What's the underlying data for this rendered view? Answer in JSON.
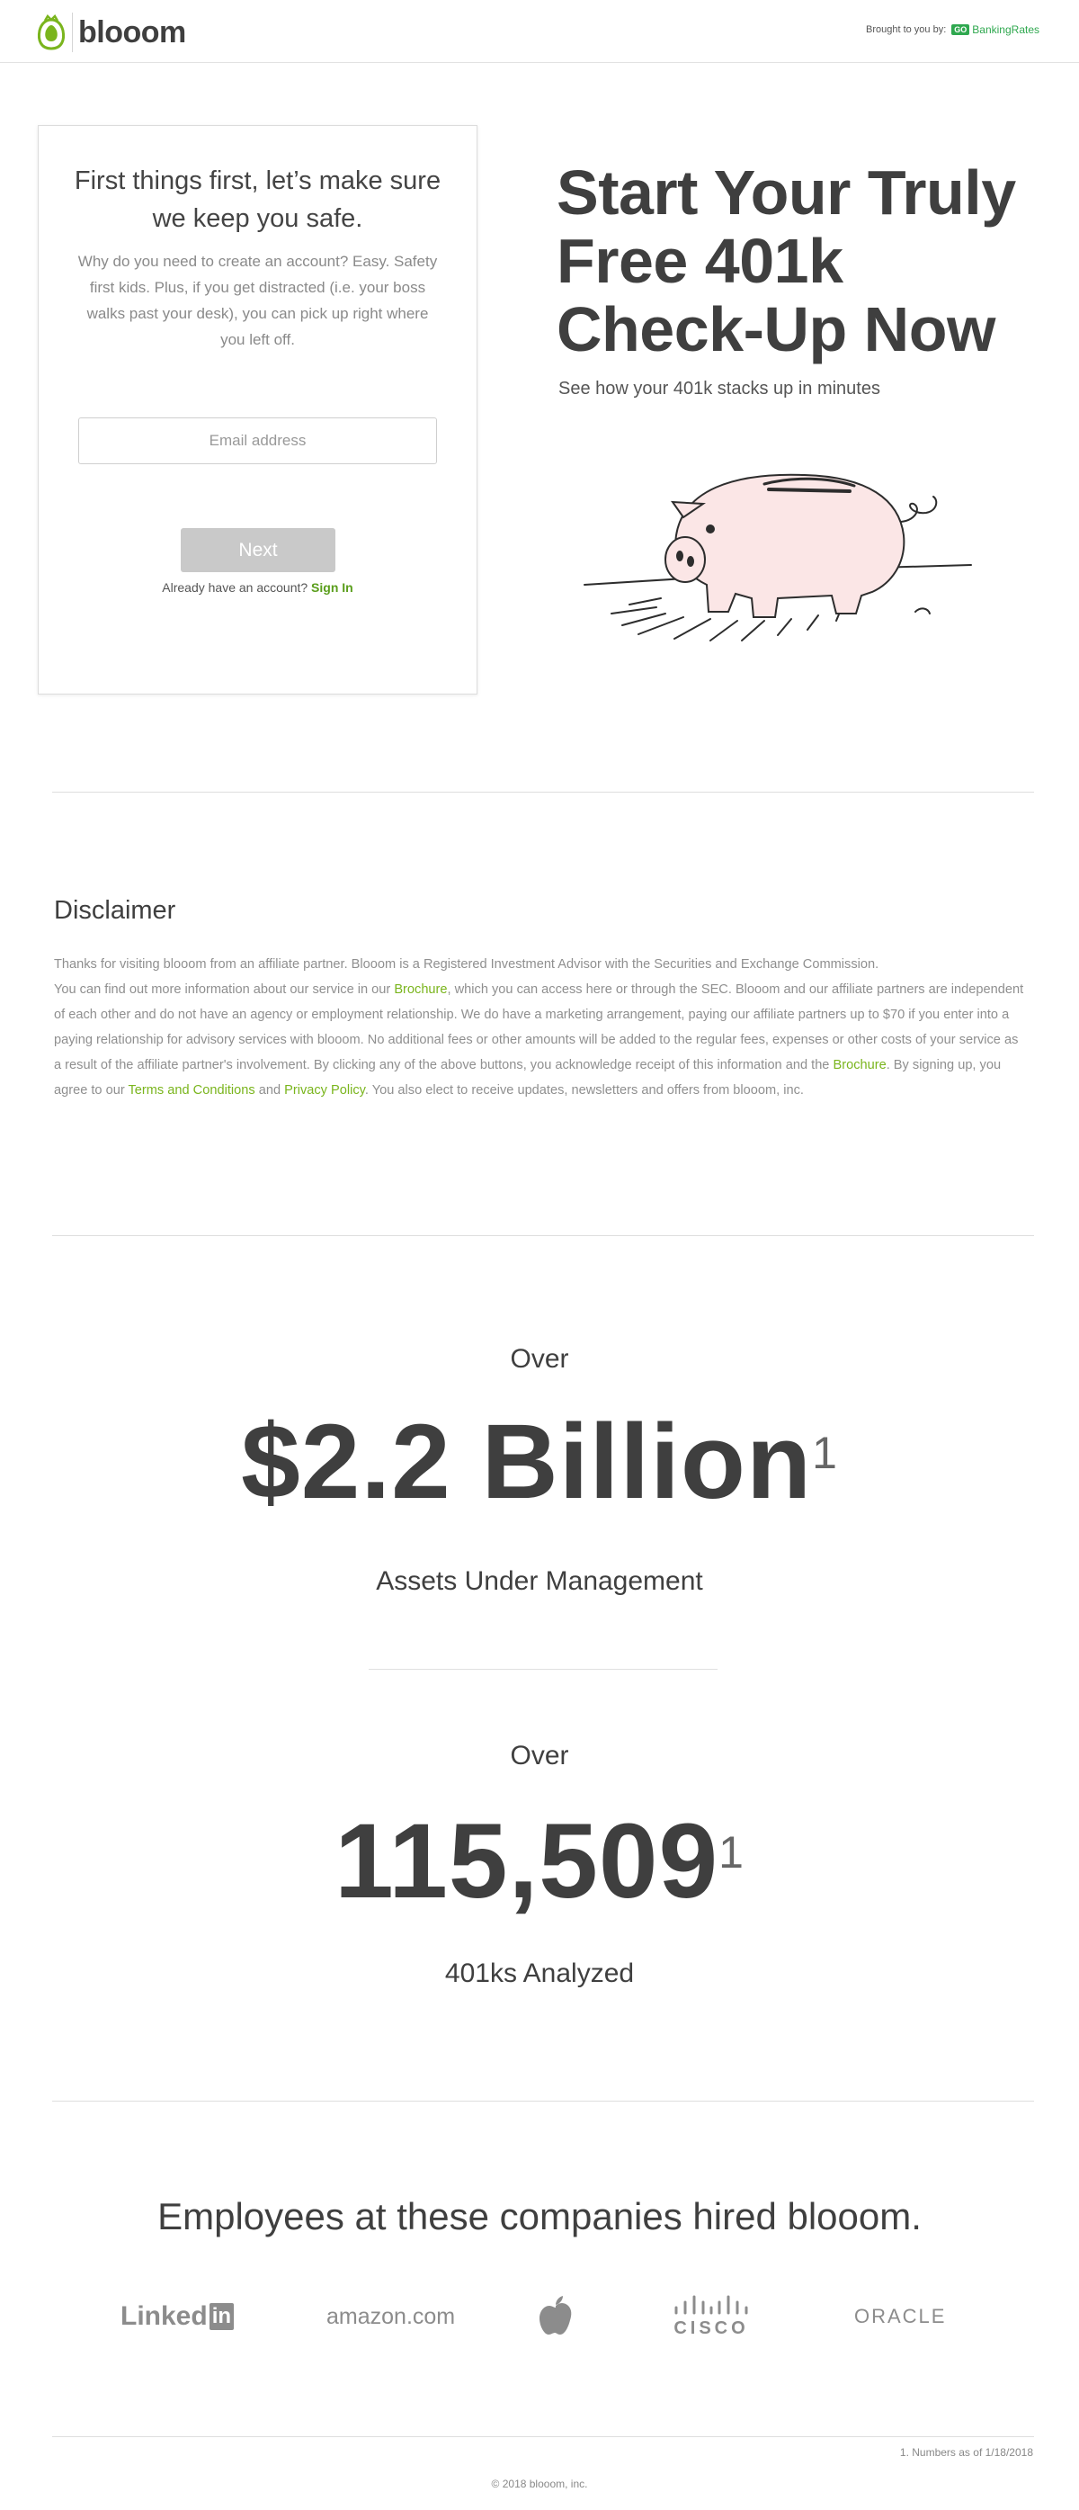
{
  "header": {
    "logo_text": "blooom",
    "brought_by": "Brought to you by:",
    "partner_box": "GO",
    "partner_name": "BankingRates"
  },
  "signup": {
    "title": "First things first, let’s make sure we keep you safe.",
    "description": "Why do you need to create an account? Easy. Safety first kids. Plus, if you get distracted (i.e. your boss walks past your desk), you can pick up right where you left off.",
    "email_placeholder": "Email address",
    "email_value": "",
    "next_label": "Next",
    "already_text": "Already have an account?",
    "signin_label": "Sign In"
  },
  "hero": {
    "title": "Start Your Truly Free 401k Check-Up Now",
    "subtitle": "See how your 401k stacks up in minutes"
  },
  "disclaimer": {
    "title": "Disclaimer",
    "p1": "Thanks for visiting blooom from an affiliate partner. Blooom is a Registered Investment Advisor with the Securities and Exchange Commission.",
    "p2": "You can find out more information about our service in our",
    "link_brochure": "Brochure",
    "p3": ", which you can access here or through the SEC. Blooom and our affiliate partners are independent of each other and do not have an agency or employment relationship. We do have a marketing arrangement, paying our affiliate partners up to $70 if you enter into a paying relationship for advisory services with blooom. No additional fees or other amounts will be added to the regular fees, expenses or other costs of your service as a result of the affiliate partner's involvement. By clicking any of the above buttons, you acknowledge receipt of this information and the",
    "p4": ". By signing up, you agree to our",
    "link_terms": "Terms and Conditions",
    "p5": "and",
    "link_privacy": "Privacy Policy",
    "p6": ". You also elect to receive updates, newsletters and offers from blooom, inc."
  },
  "stats": [
    {
      "over": "Over",
      "value": "$2.2 Billion",
      "sup": "1",
      "label": "Assets Under Management"
    },
    {
      "over": "Over",
      "value": "115,509",
      "sup": "1",
      "label": "401ks Analyzed"
    }
  ],
  "companies": {
    "title": "Employees at these companies hired blooom.",
    "linkedin": "Linked",
    "linkedin_in": "in",
    "amazon": "amazon.com",
    "apple_icon": "apple-logo-icon",
    "cisco": "CISCO",
    "oracle": "ORACLE"
  },
  "footer": {
    "footnote": "1. Numbers as of 1/18/2018",
    "copyright": "© 2018 blooom, inc."
  },
  "colors": {
    "brand_green": "#7ab51d",
    "partner_green": "#2fa84f",
    "heading": "#3f3f3f",
    "button_disabled": "#c9c9c9"
  }
}
